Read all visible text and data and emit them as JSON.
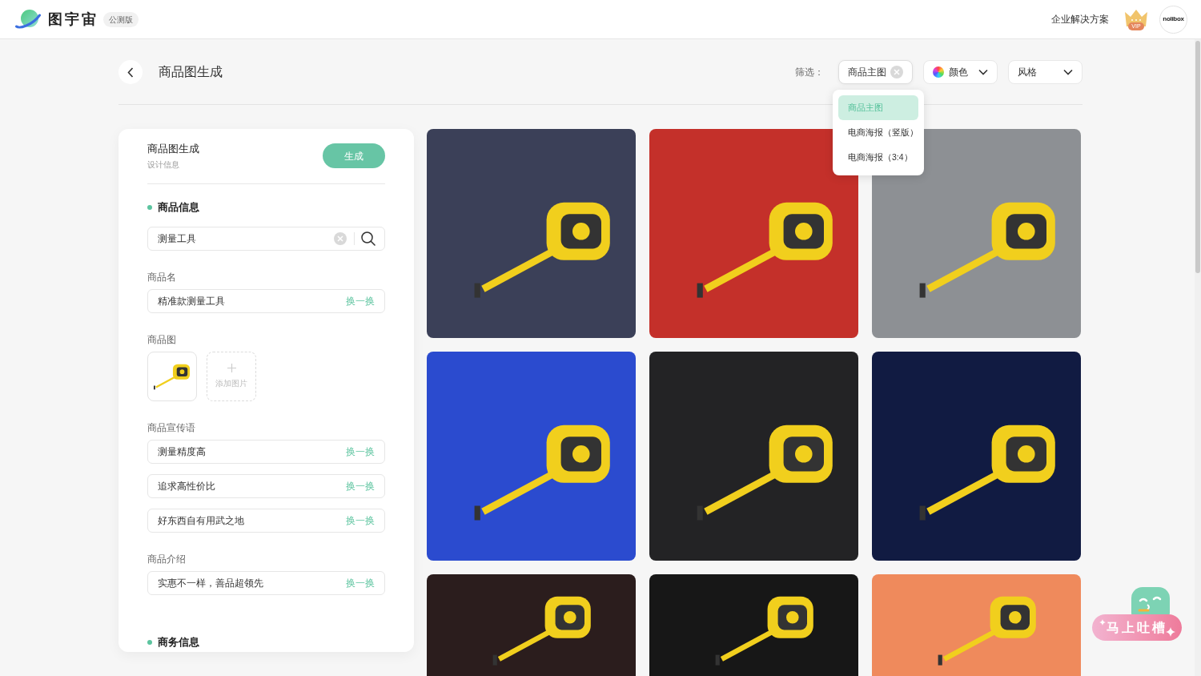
{
  "topbar": {
    "brand": "图宇宙",
    "badge": "公测版",
    "link": "企业解决方案",
    "vip": "VIP",
    "avatar": "nolibox"
  },
  "header": {
    "title": "商品图生成",
    "filter_label": "筛选：",
    "filters": [
      {
        "kind": "clearable",
        "label": "商品主图",
        "expanded": true,
        "options": [
          {
            "label": "商品主图",
            "selected": true
          },
          {
            "label": "电商海报（竖版）",
            "selected": false
          },
          {
            "label": "电商海报（3:4）",
            "selected": false
          }
        ]
      },
      {
        "kind": "color",
        "label": "颜色",
        "expanded": false
      },
      {
        "kind": "select",
        "label": "风格",
        "expanded": false
      }
    ]
  },
  "form": {
    "title": "商品图生成",
    "subtitle": "设计信息",
    "button": "生成",
    "groups": [
      {
        "kind": "heading",
        "text": "商品信息"
      },
      {
        "kind": "search",
        "value": "测量工具"
      },
      {
        "kind": "fields",
        "label": "商品名",
        "fields": [
          {
            "value": "精准款测量工具",
            "action": "换一换"
          }
        ]
      },
      {
        "kind": "images",
        "label": "商品图",
        "add_label": "添加图片"
      },
      {
        "kind": "fields",
        "label": "商品宣传语",
        "fields": [
          {
            "value": "测量精度高",
            "action": "换一换"
          },
          {
            "value": "追求高性价比",
            "action": "换一换"
          },
          {
            "value": "好东西自有用武之地",
            "action": "换一换"
          }
        ]
      },
      {
        "kind": "fields",
        "label": "商品介绍",
        "fields": [
          {
            "value": "实惠不一样，善品超领先",
            "action": "换一换"
          }
        ]
      },
      {
        "kind": "heading",
        "text": "商务信息"
      }
    ]
  },
  "posters": [
    {
      "color": "#3b4058"
    },
    {
      "color": "#c4302a"
    },
    {
      "color": "#8d9094"
    },
    {
      "color": "#2b4bcf"
    },
    {
      "color": "#232325"
    },
    {
      "color": "#111b42"
    },
    {
      "color": "#2b1d1d"
    },
    {
      "color": "#171717"
    },
    {
      "color": "#ef8a5c"
    }
  ],
  "feedback": {
    "label": "马上吐槽"
  }
}
